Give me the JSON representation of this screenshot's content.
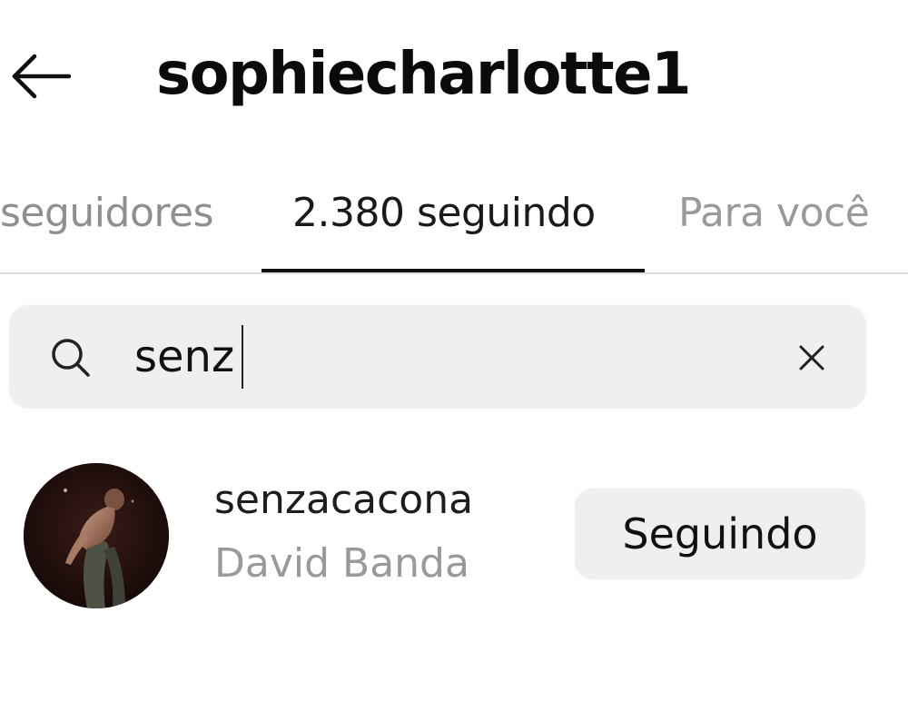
{
  "header": {
    "back_icon": "arrow-left-icon",
    "username": "sophiecharlotte1"
  },
  "tabs": [
    {
      "label": "seguidores",
      "active": false
    },
    {
      "label": "2.380 seguindo",
      "active": true
    },
    {
      "label": "Para você",
      "active": false
    }
  ],
  "search": {
    "icon": "search-icon",
    "value": "senz",
    "clear_icon": "close-icon"
  },
  "results": [
    {
      "username": "senzacacona",
      "full_name": "David Banda",
      "button_label": "Seguindo"
    }
  ],
  "colors": {
    "primary_text": "#111111",
    "secondary_text": "#9a9a9a",
    "surface": "#efefef",
    "divider": "#dcdcdc"
  }
}
